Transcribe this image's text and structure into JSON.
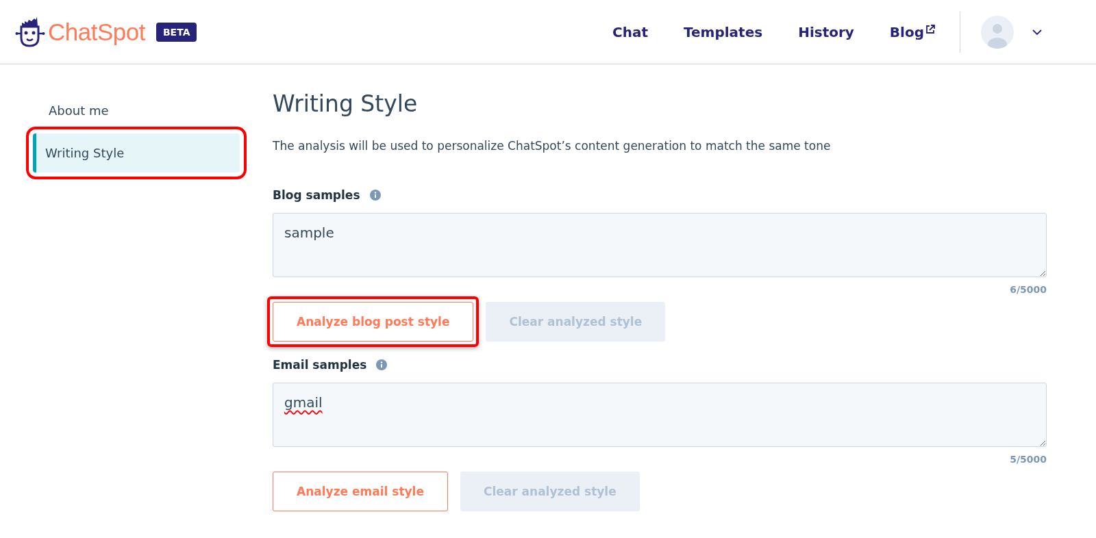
{
  "header": {
    "logo_text": "ChatSpot",
    "badge": "BETA",
    "nav": [
      {
        "label": "Chat",
        "external": false
      },
      {
        "label": "Templates",
        "external": false
      },
      {
        "label": "History",
        "external": false
      },
      {
        "label": "Blog",
        "external": true
      }
    ]
  },
  "sidebar": {
    "items": [
      {
        "label": "About me",
        "selected": false,
        "highlighted": false
      },
      {
        "label": "Writing Style",
        "selected": true,
        "highlighted": true
      }
    ]
  },
  "main": {
    "title": "Writing Style",
    "description": "The analysis will be used to personalize ChatSpot’s content generation to match the same tone",
    "sections": [
      {
        "label": "Blog samples",
        "value": "sample",
        "counter": "6/5000",
        "analyze_button": "Analyze blog post style",
        "analyze_highlighted": true,
        "clear_button": "Clear analyzed style",
        "clear_disabled": true,
        "spellcheck_error": false
      },
      {
        "label": "Email samples",
        "value": "gmail",
        "counter": "5/5000",
        "analyze_button": "Analyze email style",
        "analyze_highlighted": false,
        "clear_button": "Clear analyzed style",
        "clear_disabled": true,
        "spellcheck_error": true
      }
    ]
  }
}
